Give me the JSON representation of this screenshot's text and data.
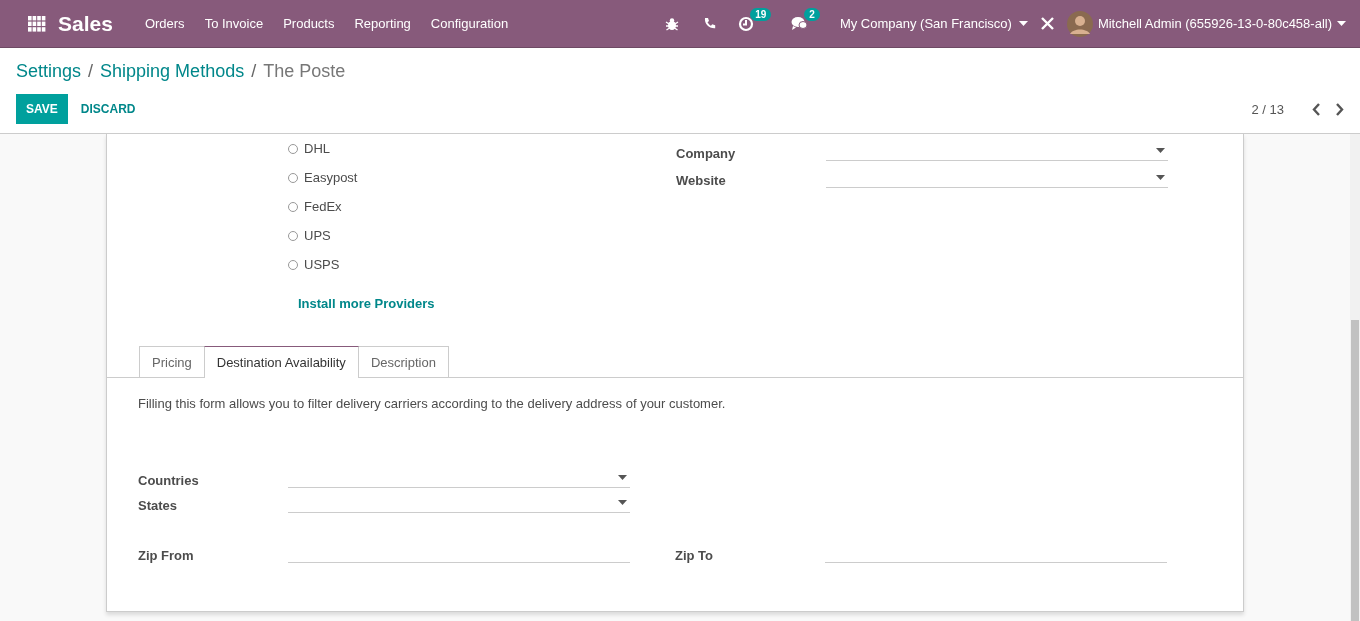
{
  "navbar": {
    "app_name": "Sales",
    "menu": [
      "Orders",
      "To Invoice",
      "Products",
      "Reporting",
      "Configuration"
    ],
    "activity_count": "19",
    "message_count": "2",
    "company": "My Company (San Francisco)",
    "user": "Mitchell Admin (655926-13-0-80c458-all)"
  },
  "breadcrumbs": [
    {
      "label": "Settings",
      "current": false
    },
    {
      "separator": "/",
      "label": "Shipping Methods",
      "current": false
    },
    {
      "separator": "/",
      "label": "The Poste",
      "current": true
    }
  ],
  "buttons": {
    "save": "SAVE",
    "discard": "DISCARD"
  },
  "pager": "2 / 13",
  "providers": [
    {
      "label": "DHL",
      "selected": false
    },
    {
      "label": "Easypost",
      "selected": false
    },
    {
      "label": "FedEx",
      "selected": false
    },
    {
      "label": "UPS",
      "selected": false
    },
    {
      "label": "USPS",
      "selected": false
    }
  ],
  "install_link": "Install more Providers",
  "right_fields": [
    {
      "label": "Company",
      "kind": "select"
    },
    {
      "label": "Website",
      "kind": "select"
    }
  ],
  "tabs": [
    {
      "label": "Pricing",
      "selected": false
    },
    {
      "label": "Destination Availability",
      "selected": true
    },
    {
      "label": "Description",
      "selected": false
    }
  ],
  "help_text": "Filling this form allows you to filter delivery carriers according to the delivery address of your customer.",
  "countries_label": "Countries",
  "states_label": "States",
  "zip_from_label": "Zip From",
  "zip_to_label": "Zip To"
}
